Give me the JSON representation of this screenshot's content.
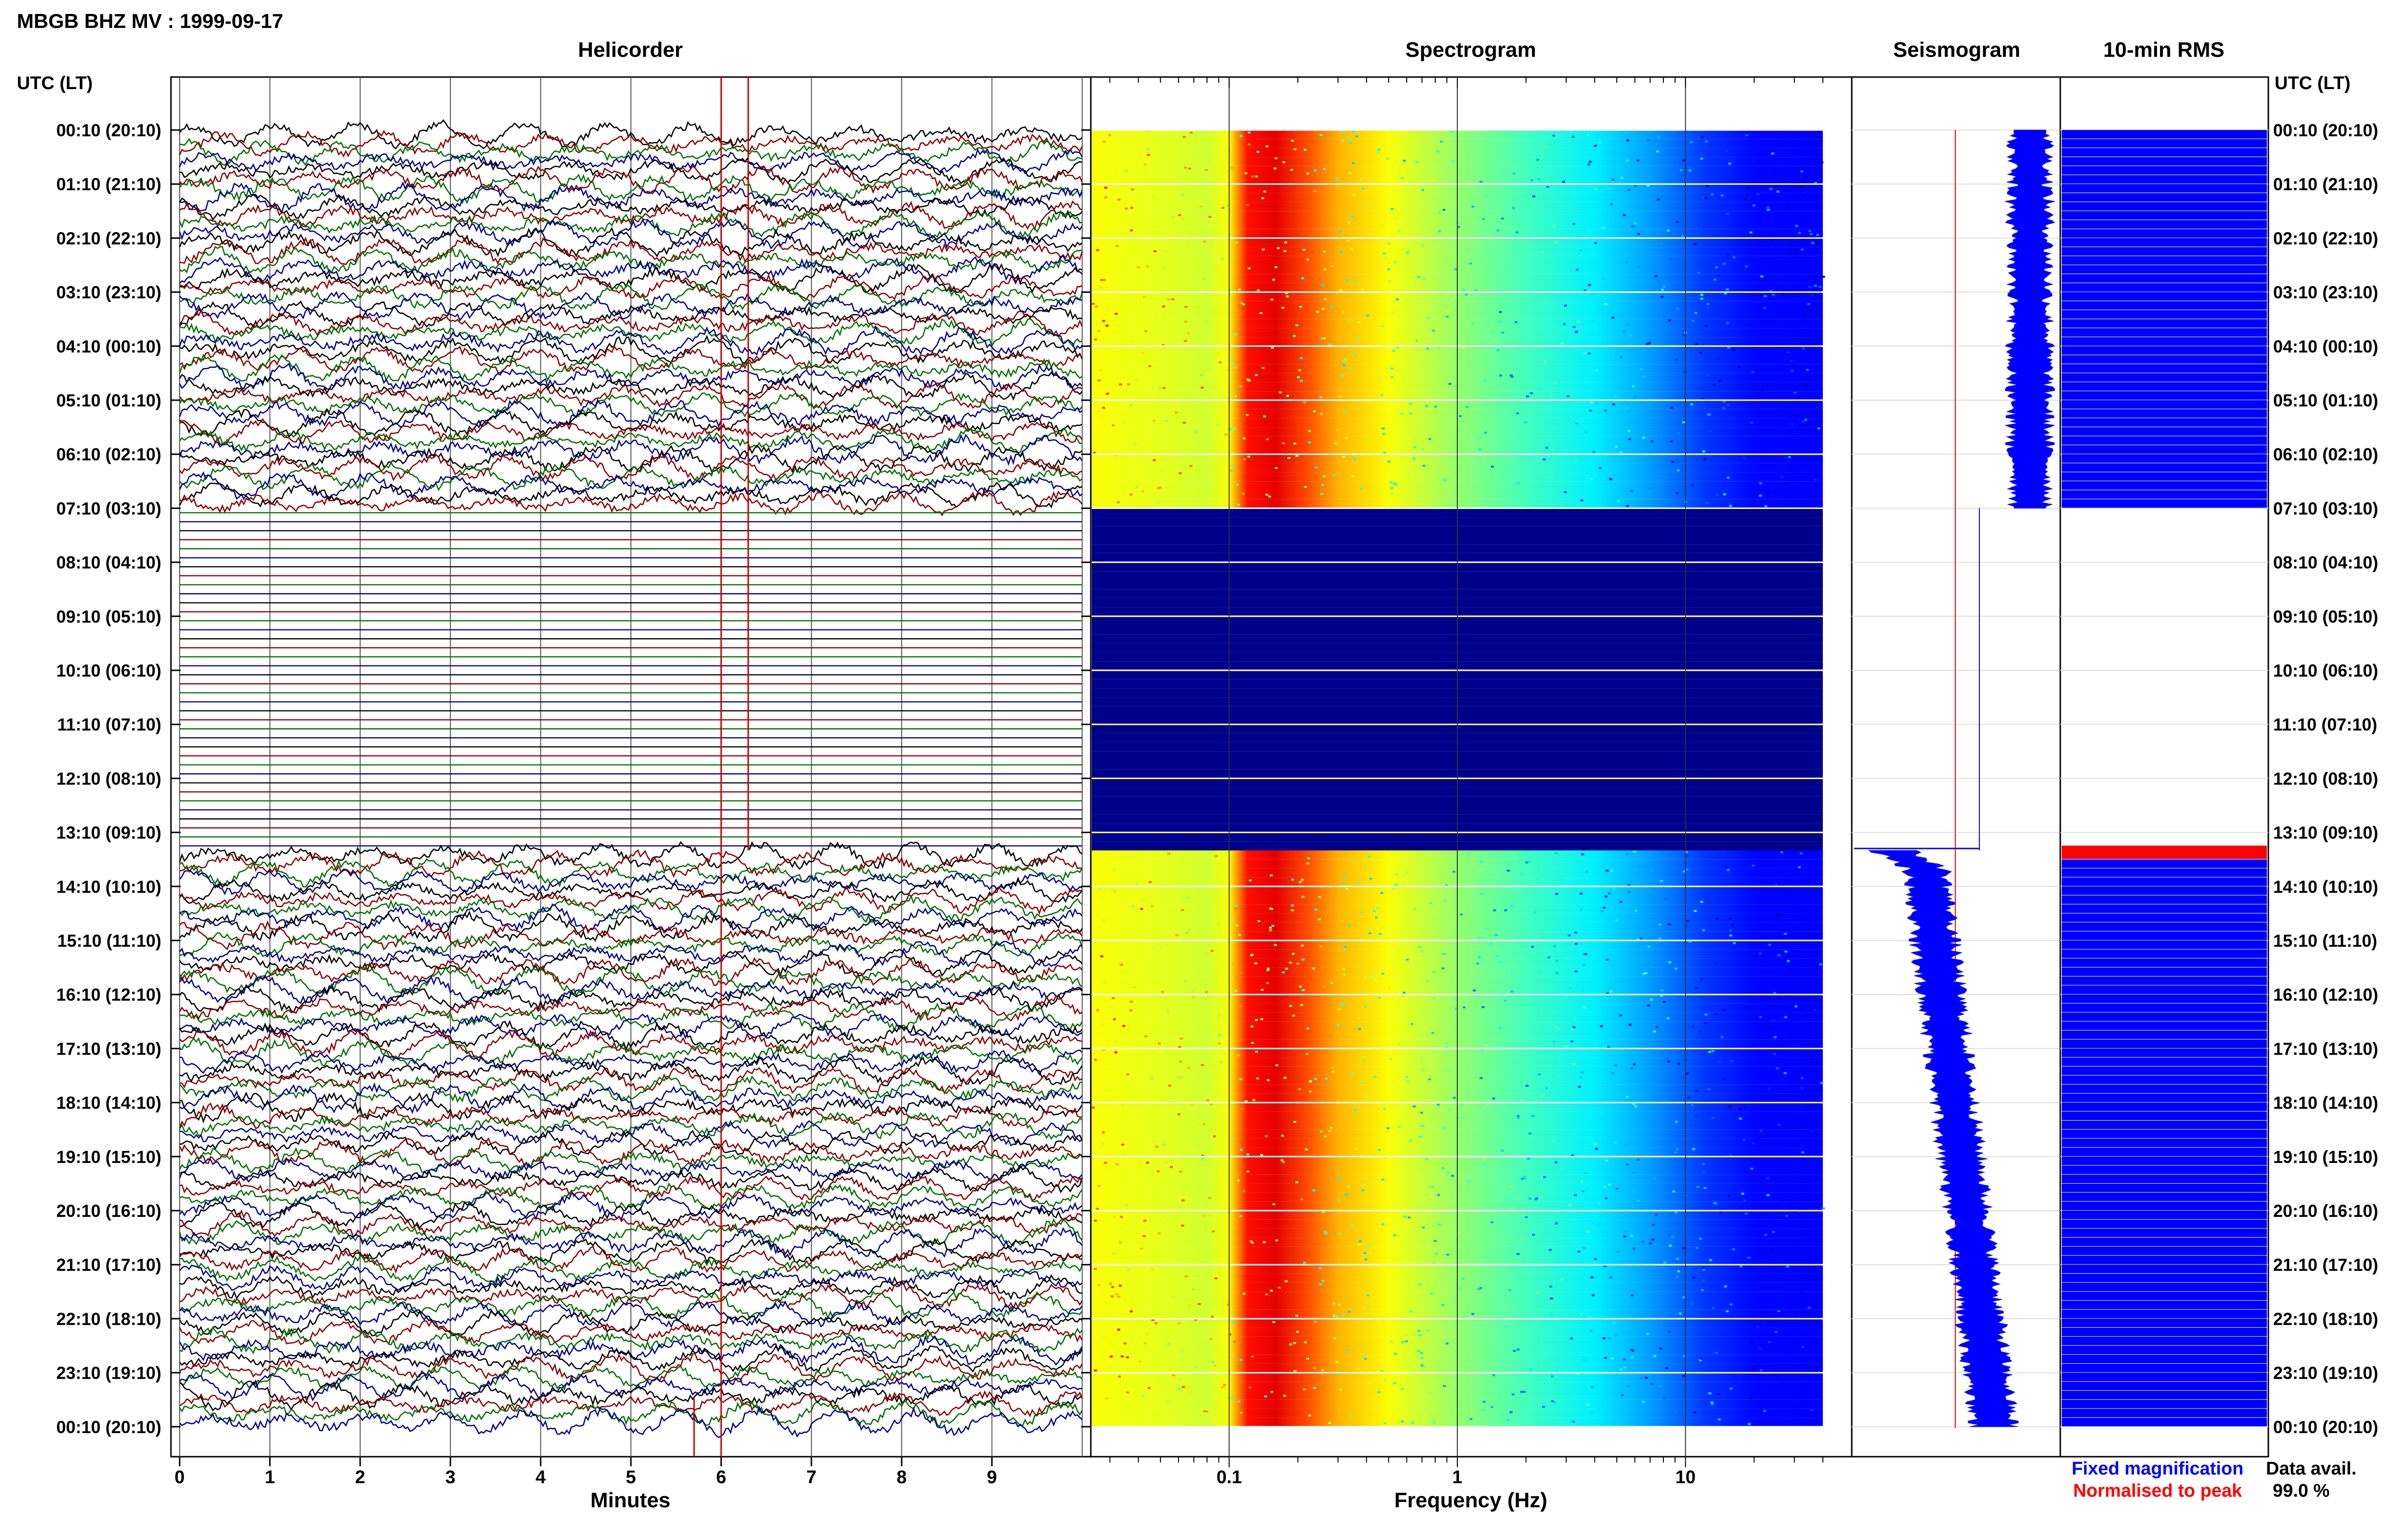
{
  "header": {
    "title": "MBGB BHZ MV : 1999-09-17"
  },
  "panels": {
    "helicorder": "Helicorder",
    "spectrogram": "Spectrogram",
    "seismogram": "Seismogram",
    "rms": "10-min RMS"
  },
  "axis": {
    "time_label_left": "UTC (LT)",
    "time_label_right": "UTC (LT)",
    "minutes_label": "Minutes",
    "frequency_label": "Frequency (Hz)",
    "minute_ticks": [
      "0",
      "1",
      "2",
      "3",
      "4",
      "5",
      "6",
      "7",
      "8",
      "9"
    ],
    "frequency_ticks": [
      "0.1",
      "1",
      "10"
    ]
  },
  "time_labels": [
    "00:10 (20:10)",
    "01:10 (21:10)",
    "02:10 (22:10)",
    "03:10 (23:10)",
    "04:10 (00:10)",
    "05:10 (01:10)",
    "06:10 (02:10)",
    "07:10 (03:10)",
    "08:10 (04:10)",
    "09:10 (05:10)",
    "10:10 (06:10)",
    "11:10 (07:10)",
    "12:10 (08:10)",
    "13:10 (09:10)",
    "14:10 (10:10)",
    "15:10 (11:10)",
    "16:10 (12:10)",
    "17:10 (13:10)",
    "18:10 (14:10)",
    "19:10 (15:10)",
    "20:10 (16:10)",
    "21:10 (17:10)",
    "22:10 (18:10)",
    "23:10 (19:10)",
    "00:10 (20:10)"
  ],
  "legend": {
    "fixed": "Fixed magnification",
    "normalised": "Normalised to peak",
    "fixed_color": "#0000ff",
    "normalised_color": "#ff0000"
  },
  "availability": {
    "label": "Data avail.",
    "value": "99.0 %"
  },
  "chart_data": {
    "type": "heatmap",
    "title": "MBGB BHZ MV : 1999-09-17",
    "rows_per_hour": 6,
    "trace_colors": [
      "#000000",
      "#8b0000",
      "#007000",
      "#00008b"
    ],
    "data_gap": {
      "start_row": 42,
      "end_row": 80
    },
    "helicorder": {
      "xlabel": "Minutes",
      "xlim": [
        0,
        10
      ],
      "marker_minutes": [
        6.0,
        6.3,
        5.7
      ]
    },
    "spectrogram": {
      "xlabel": "Frequency (Hz)",
      "xscale": "log",
      "xlim": [
        0.025,
        40
      ],
      "peak_band_hz": [
        0.1,
        0.25
      ]
    },
    "seismogram": {
      "fixed_color": "#0000ff",
      "normalised_color": "#ff0000"
    },
    "rms": {
      "color": "#0000ff",
      "peak_row": 80,
      "peak_color": "#ff0000"
    },
    "data_availability_percent": 99.0
  }
}
